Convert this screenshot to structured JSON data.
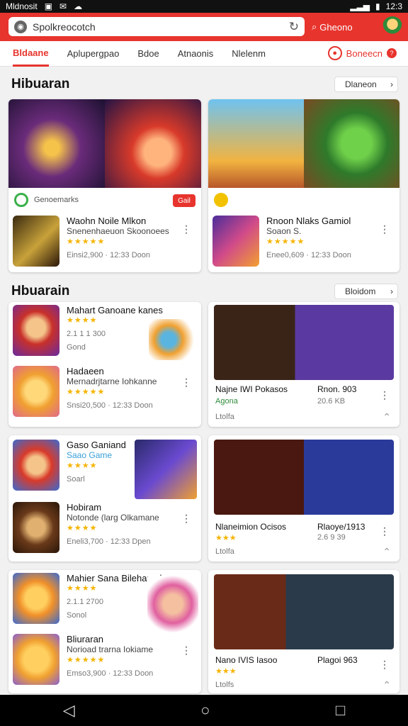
{
  "status": {
    "carrier": "Mldnosit",
    "time": "12:3"
  },
  "search": {
    "value": "Spolkreocotch",
    "button": "Gheono"
  },
  "tabs": [
    {
      "label": "Bldaane"
    },
    {
      "label": "Aplupergpao"
    },
    {
      "label": "Bdoe"
    },
    {
      "label": "Atnaonis"
    },
    {
      "label": "Nlelenm"
    }
  ],
  "tab_right": {
    "label": "Boneecn",
    "badge": "?"
  },
  "section1": {
    "title": "Hibuaran",
    "button": "Dlaneon",
    "card_a": {
      "meta": "Genoemarks",
      "pill": "Gail",
      "title": "Waohn Noile Mlkon",
      "sub": "Snenenhaeuon Skoonoees",
      "stars": "★★★★★",
      "size": "Einsi2,900 · 12:33 Doon"
    },
    "card_b": {
      "title": "Rnoon Nlaks Gamiol",
      "sub": "Soaon S.",
      "stars": "★★★★★",
      "size": "Enee0,609 · 12:33 Doon"
    }
  },
  "section2": {
    "title": "Hbuarain",
    "button": "Bloidom",
    "left_items": [
      {
        "title": "Mahart Ganoane kanes",
        "rating": "★★★★",
        "count": "2.1 1 1 300",
        "tag": "Gond",
        "size": ""
      },
      {
        "title": "Hadaeen",
        "sub": "Mernadrjtarne Iohkanne",
        "stars": "★★★★★",
        "size": "Snsi20,500 · 12:33 Doon"
      },
      {
        "title": "Gaso Ganiand",
        "sub": "Saao Game",
        "rating": "★★★★",
        "count": "",
        "tag": "Soarl",
        "size": ""
      },
      {
        "title": "Hobiram",
        "sub": "Notonde (larg Olkamane",
        "stars": "★★★★",
        "size": "Eneli3,700 · 12:33 Dpen"
      },
      {
        "title": "Mahier Sana Bilehamok",
        "rating": "★★★★",
        "count": "2.1.1 2700",
        "tag": "Sonol",
        "size": ""
      },
      {
        "title": "Bliuraran",
        "sub": "Norioad trarna Iokiame",
        "stars": "★★★★★",
        "size": "Emso3,900 · 12:33 Doon"
      }
    ],
    "right_items": [
      {
        "left_title": "Najne IWI Pokasos",
        "left_sub": "Agona",
        "right_title": "Rnon. 903",
        "right_sub": "20.6 KB",
        "bottom": "Ltolfa"
      },
      {
        "left_title": "Nlaneimion Ocisos",
        "left_sub": "★★★",
        "right_title": "Rlaoye/1913",
        "right_sub": "2.6 9 39",
        "bottom": "Ltolfa"
      },
      {
        "left_title": "Nano IVIS Iasoo",
        "left_sub": "★★★",
        "right_title": "Plagoi 963",
        "right_sub": "",
        "bottom": "Ltolfs"
      }
    ]
  },
  "colors": {
    "accent": "#e7342d",
    "star": "#f5b400"
  }
}
